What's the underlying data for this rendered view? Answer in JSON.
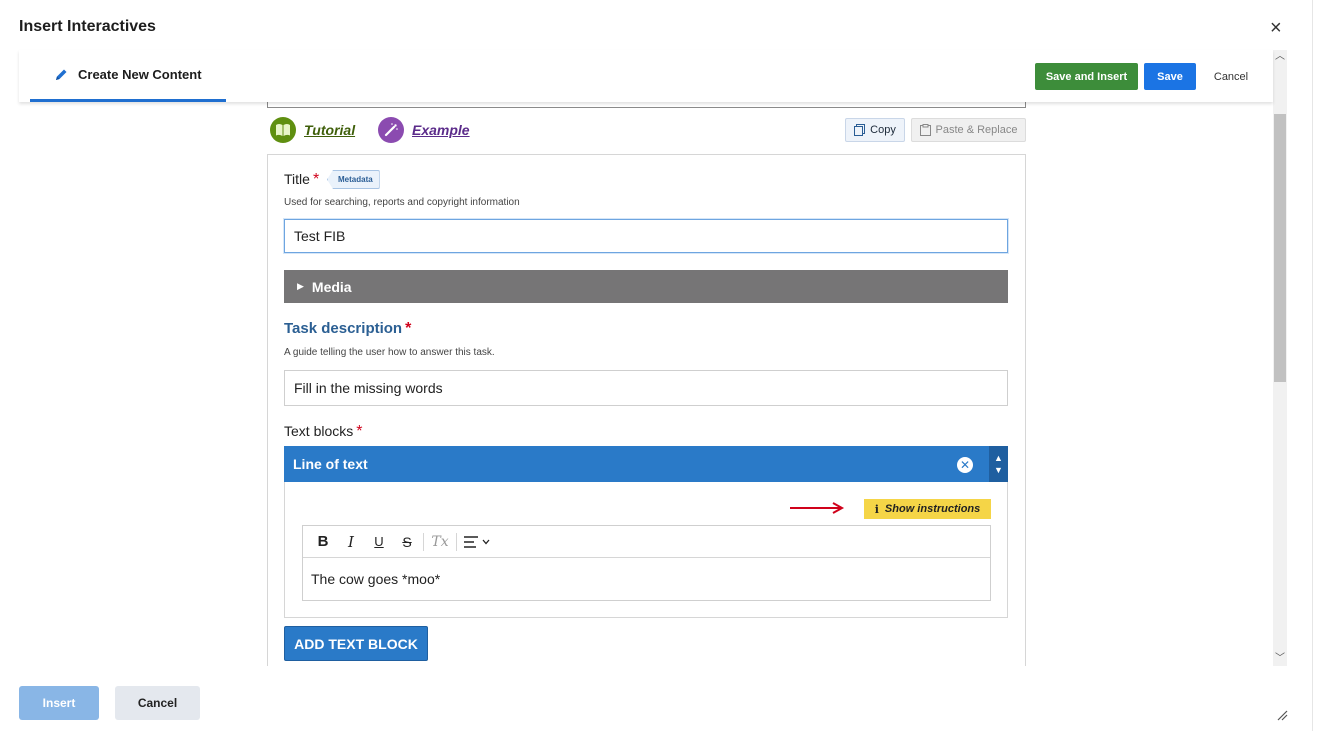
{
  "dialog": {
    "title": "Insert Interactives",
    "close_symbol": "×"
  },
  "header": {
    "tab_label": "Create New Content",
    "tab_icon": "pencil-icon",
    "save_and_insert_label": "Save and Insert",
    "save_label": "Save",
    "cancel_label": "Cancel"
  },
  "links": {
    "tutorial_label": "Tutorial",
    "example_label": "Example",
    "copy_label": "Copy",
    "paste_replace_label": "Paste & Replace"
  },
  "form": {
    "title_label": "Title",
    "required_marker": "*",
    "metadata_badge": "Metadata",
    "title_hint": "Used for searching, reports and copyright information",
    "title_value": "Test FIB",
    "media_label": "Media",
    "task_description_label": "Task description",
    "task_description_hint": "A guide telling the user how to answer this task.",
    "task_description_value": "Fill in the missing words",
    "text_blocks_label": "Text blocks",
    "line_of_text_label": "Line of text",
    "show_instructions_label": "Show instructions",
    "editor_content": "The cow goes *moo*",
    "add_text_block_label": "ADD TEXT BLOCK"
  },
  "toolbar": {
    "bold": "B",
    "italic": "I",
    "underline": "U",
    "strike": "S",
    "clear_format": "Tx"
  },
  "footer": {
    "insert_label": "Insert",
    "cancel_label": "Cancel"
  },
  "colors": {
    "save_and_insert_bg": "#3d8d3a",
    "save_bg": "#1b74e4",
    "blue_accent": "#2a7ac8",
    "media_bar": "#767576",
    "highlight_yellow": "#f5d547",
    "required_red": "#d0021b"
  }
}
